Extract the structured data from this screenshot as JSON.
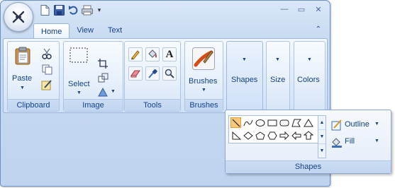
{
  "quick_access": {
    "icons": [
      "new-document-icon",
      "save-icon",
      "undo-icon",
      "print-icon"
    ],
    "more": "▾"
  },
  "window_controls": {
    "minimize": "—",
    "maximize": "▭",
    "close": "✕"
  },
  "tabs": [
    {
      "label": "Home",
      "active": true
    },
    {
      "label": "View",
      "active": false
    },
    {
      "label": "Text",
      "active": false
    }
  ],
  "collapse_ribbon": "⌃",
  "groups": {
    "clipboard": {
      "title": "Clipboard",
      "paste_label": "Paste"
    },
    "image": {
      "title": "Image",
      "select_label": "Select"
    },
    "tools": {
      "title": "Tools",
      "text_tool": "A"
    },
    "brushes": {
      "title": "Brushes",
      "label": "Brushes"
    },
    "shapes": {
      "label": "Shapes"
    },
    "size": {
      "label": "Size"
    },
    "colors": {
      "label": "Colors"
    }
  },
  "shapes_popup": {
    "title": "Shapes",
    "outline_label": "Outline",
    "fill_label": "Fill",
    "shapes": [
      "line",
      "curve",
      "oval",
      "rectangle",
      "rounded-rectangle",
      "polygon",
      "triangle",
      "right-triangle",
      "diamond",
      "pentagon",
      "hexagon",
      "right-arrow",
      "left-arrow",
      "up-arrow"
    ]
  },
  "colors": {
    "accent": "#15428b",
    "ribbon": "#d1e1f6",
    "selected_shape": "#f9c97a"
  }
}
